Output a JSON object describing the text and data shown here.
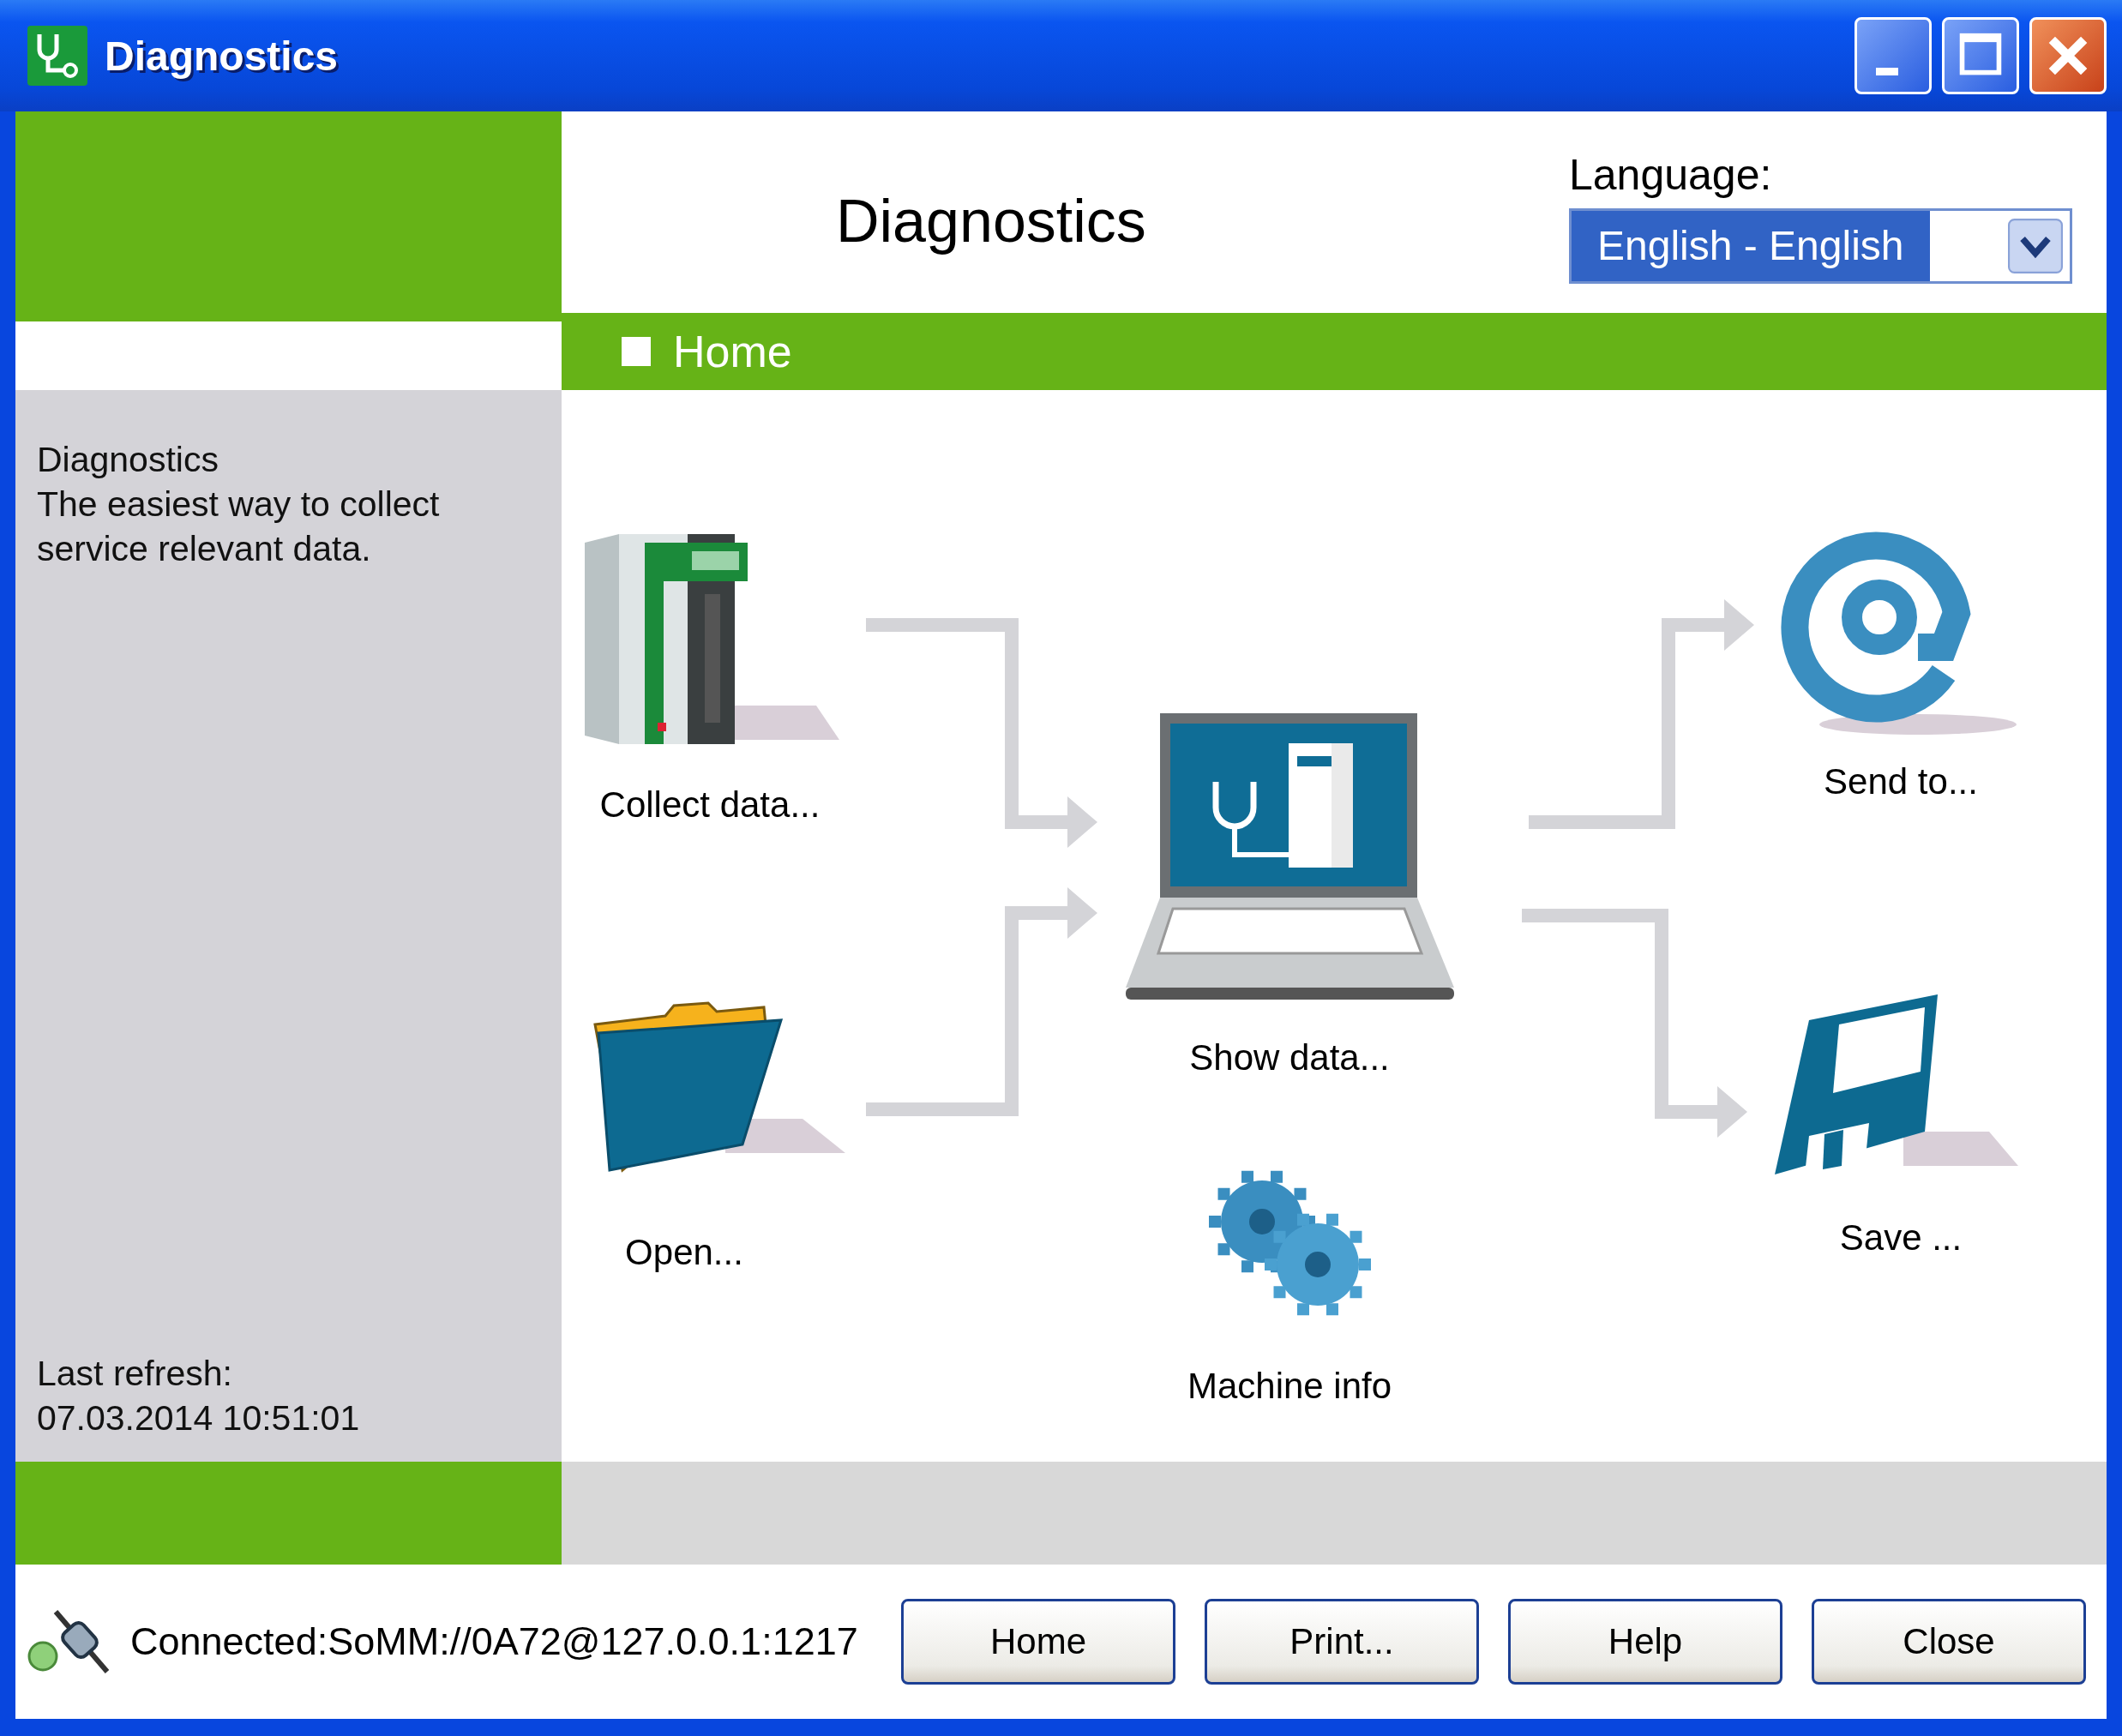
{
  "window": {
    "title": "Diagnostics"
  },
  "header": {
    "title": "Diagnostics",
    "language_label": "Language:",
    "language_value": "English - English"
  },
  "breadcrumb": "Home",
  "sidebar": {
    "title": "Diagnostics",
    "description": "The easiest way to collect service relevant data.",
    "refresh_label": "Last refresh:",
    "refresh_time": "07.03.2014 10:51:01"
  },
  "actions": [
    {
      "kind": "collect",
      "label": "Collect data..."
    },
    {
      "kind": "open",
      "label": "Open..."
    },
    {
      "kind": "show",
      "label": "Show data..."
    },
    {
      "kind": "machine",
      "label": "Machine info"
    },
    {
      "kind": "send",
      "label": "Send to..."
    },
    {
      "kind": "save",
      "label": "Save ..."
    }
  ],
  "status": "Connected:SoMM://0A72@127.0.0.1:1217",
  "buttons": [
    "Home",
    "Print...",
    "Help",
    "Close"
  ]
}
